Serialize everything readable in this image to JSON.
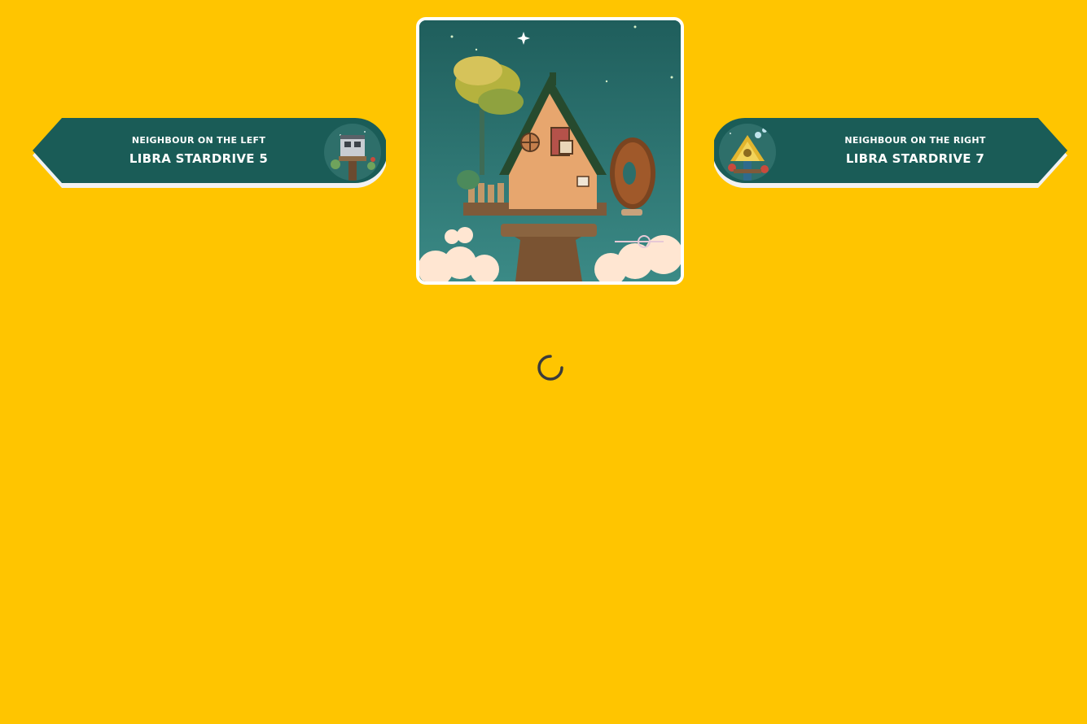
{
  "colors": {
    "background": "#FFC500",
    "pill": "#1A5C57",
    "pill_shadow": "#F2F2F2",
    "text": "#FFFFFF",
    "spinner": "#3B3B3B"
  },
  "left_neighbour": {
    "caption": "Neighbour on the left",
    "name": "Libra Stardrive 5",
    "icon": "treehouse-thumbnail"
  },
  "right_neighbour": {
    "caption": "Neighbour on the right",
    "name": "Libra Stardrive 7",
    "icon": "treehouse-thumbnail"
  },
  "main_image": {
    "icon": "treehouse-illustration"
  },
  "loading": {
    "icon": "loading-spinner"
  }
}
